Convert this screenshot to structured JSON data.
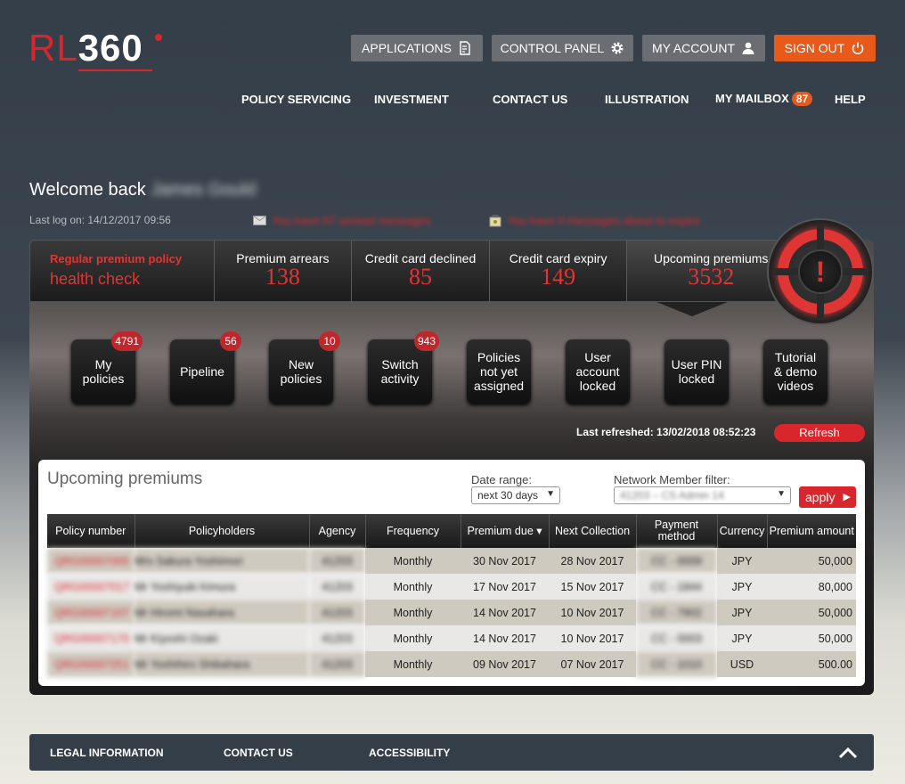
{
  "logo": {
    "text_red": "RL",
    "text_white": "360"
  },
  "top_buttons": {
    "applications": "APPLICATIONS",
    "control_panel": "CONTROL PANEL",
    "my_account": "MY ACCOUNT",
    "sign_out": "SIGN OUT"
  },
  "nav": {
    "policy_servicing": "POLICY SERVICING",
    "investment": "INVESTMENT",
    "contact_us": "CONTACT US",
    "illustration": "ILLUSTRATION",
    "my_mailbox": "MY MAILBOX",
    "mailbox_count": "87",
    "help": "HELP"
  },
  "welcome": {
    "prefix": "Welcome back",
    "name": "James Gould"
  },
  "last_logon": "Last log on: 14/12/2017 09:56",
  "messages": {
    "unread": "You have 87 unread messages",
    "expire": "You have 0 messages about to expire"
  },
  "stats": {
    "health_title": "Regular premium policy",
    "health_sub": "health check",
    "items": [
      {
        "label": "Premium arrears",
        "value": "138"
      },
      {
        "label": "Credit card declined",
        "value": "85"
      },
      {
        "label": "Credit card expiry",
        "value": "149"
      },
      {
        "label": "Upcoming premiums",
        "value": "3532"
      }
    ]
  },
  "alarm_symbol": "!",
  "tiles": [
    {
      "label": "My\npolicies",
      "badge": "4791"
    },
    {
      "label": "Pipeline",
      "badge": "56"
    },
    {
      "label": "New\npolicies",
      "badge": "10"
    },
    {
      "label": "Switch\nactivity",
      "badge": "943"
    },
    {
      "label": "Policies\nnot yet\nassigned",
      "badge": ""
    },
    {
      "label": "User\naccount\nlocked",
      "badge": ""
    },
    {
      "label": "User PIN\nlocked",
      "badge": ""
    },
    {
      "label": "Tutorial\n& demo\nvideos",
      "badge": ""
    }
  ],
  "refresh": {
    "last_refreshed": "Last refreshed: 13/02/2018 08:52:23",
    "button": "Refresh"
  },
  "upcoming": {
    "title": "Upcoming premiums",
    "date_range_label": "Date range:",
    "date_range_value": "next 30 days",
    "network_label": "Network Member filter:",
    "network_value": "41203 – CS Admin 14",
    "apply": "apply",
    "columns": [
      "Policy number",
      "Policyholders",
      "Agency",
      "Frequency",
      "Premium due ▾",
      "Next Collection",
      "Payment method",
      "Currency",
      "Premium amount"
    ],
    "rows": [
      [
        "QRG00007005",
        "Mrs Sakura Yoshimori",
        "41203",
        "Monthly",
        "30 Nov 2017",
        "28 Nov 2017",
        "CC - 0009",
        "JPY",
        "50,000"
      ],
      [
        "QRG00007017",
        "Mr Yoshiyuki Kimura",
        "41203",
        "Monthly",
        "17 Nov 2017",
        "15 Nov 2017",
        "CC - 1844",
        "JPY",
        "80,000"
      ],
      [
        "QRG00007107",
        "Mr Hiromi Nasahara",
        "41203",
        "Monthly",
        "14 Nov 2017",
        "10 Nov 2017",
        "CC - 7902",
        "JPY",
        "50,000"
      ],
      [
        "QRG00007170",
        "Mr Kiyoshi Ozaki",
        "41203",
        "Monthly",
        "14 Nov 2017",
        "10 Nov 2017",
        "CC - 0003",
        "JPY",
        "50,000"
      ],
      [
        "QRG00007251",
        "Mr Yoshihiro Shibahara",
        "41203",
        "Monthly",
        "09 Nov 2017",
        "07 Nov 2017",
        "CC - 1010",
        "USD",
        "500.00"
      ]
    ]
  },
  "footer": {
    "legal": "LEGAL INFORMATION",
    "contact": "CONTACT US",
    "accessibility": "ACCESSIBILITY"
  },
  "colors": {
    "brand_red": "#d9262c",
    "orange": "#e85a1a",
    "dark": "#343e48"
  }
}
